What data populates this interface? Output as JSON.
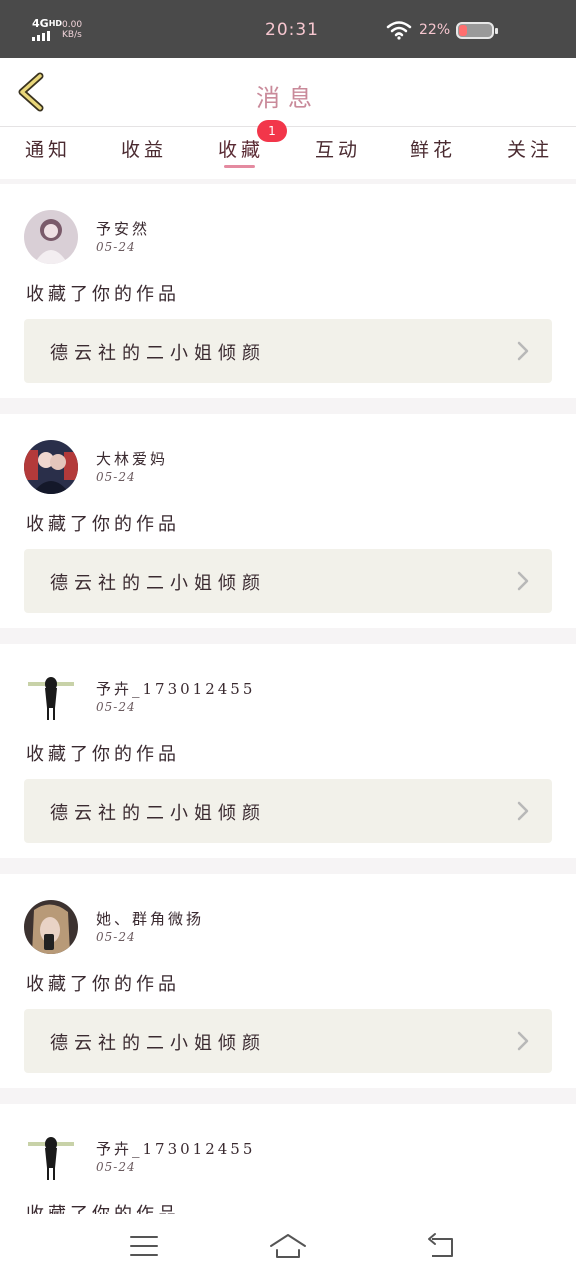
{
  "status_bar": {
    "network": "4G",
    "network_suffix": "HD",
    "speed_value": "0.00",
    "speed_unit": "KB/s",
    "time": "20:31",
    "battery": "22%"
  },
  "header": {
    "title": "消息",
    "back_icon": "chevron-left-icon"
  },
  "tabs": [
    {
      "label": "通知"
    },
    {
      "label": "收益"
    },
    {
      "label": "收藏",
      "active": true,
      "badge": "1"
    },
    {
      "label": "互动"
    },
    {
      "label": "鲜花"
    },
    {
      "label": "关注"
    }
  ],
  "notifications": [
    {
      "username": "予安然",
      "date": "05-24",
      "action": "收藏了你的作品",
      "work_title": "德云社的二小姐倾颜"
    },
    {
      "username": "大林爱妈",
      "date": "05-24",
      "action": "收藏了你的作品",
      "work_title": "德云社的二小姐倾颜"
    },
    {
      "username": "予卉_173012455",
      "date": "05-24",
      "action": "收藏了你的作品",
      "work_title": "德云社的二小姐倾颜"
    },
    {
      "username": "她、群角微扬",
      "date": "05-24",
      "action": "收藏了你的作品",
      "work_title": "德云社的二小姐倾颜"
    },
    {
      "username": "予卉_173012455",
      "date": "05-24",
      "action": "收藏了你的作品",
      "work_title": ""
    }
  ],
  "nav": {
    "menu_icon": "menu-icon",
    "home_icon": "home-icon",
    "back_icon": "return-icon"
  },
  "colors": {
    "accent": "#e48aa0",
    "badge": "#f2364a",
    "work_box": "#f2f1ea"
  }
}
